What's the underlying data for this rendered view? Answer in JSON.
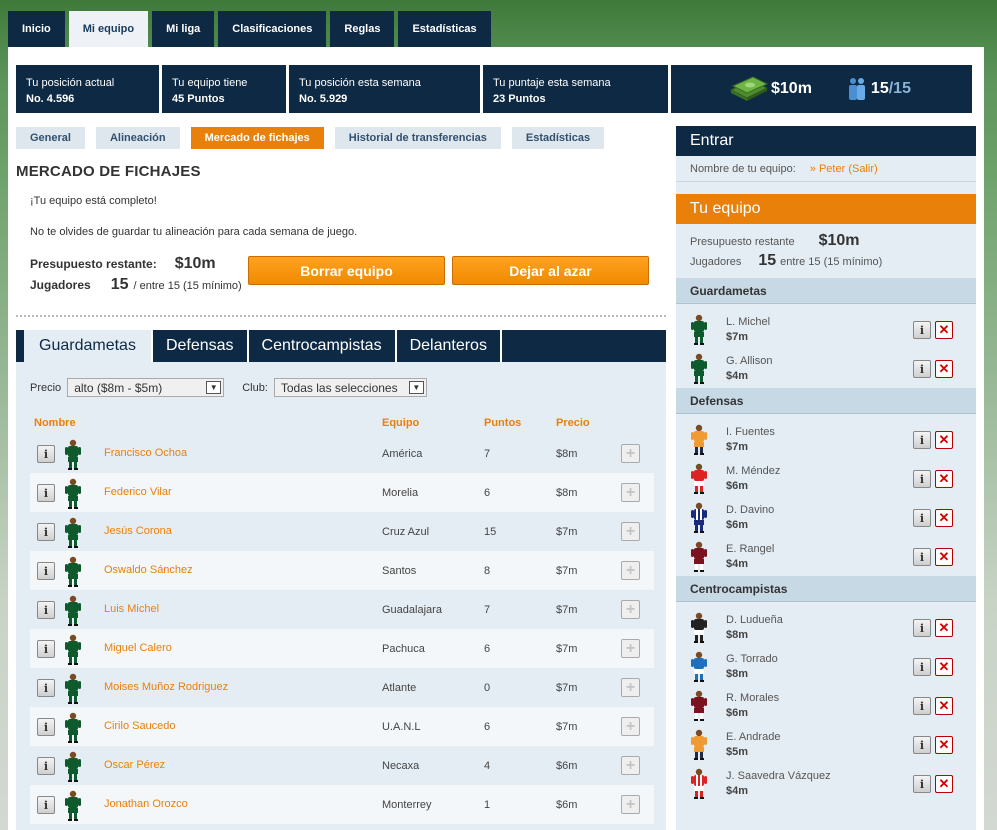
{
  "nav": {
    "tabs": [
      "Inicio",
      "Mi equipo",
      "Mi liga",
      "Clasificaciones",
      "Reglas",
      "Estadísticas"
    ],
    "active": 1
  },
  "stats": [
    {
      "label": "Tu posición actual",
      "value": "No. 4.596"
    },
    {
      "label": "Tu equipo tiene",
      "value": "45 Puntos"
    },
    {
      "label": "Tu posición esta semana",
      "value": "No. 5.929"
    },
    {
      "label": "Tu puntaje esta semana",
      "value": "23 Puntos"
    }
  ],
  "summary": {
    "budget": "$10m",
    "players_count": "15",
    "players_total": "/15"
  },
  "subtabs": {
    "items": [
      "General",
      "Alineación",
      "Mercado de fichajes",
      "Historial de transferencias",
      "Estadísticas"
    ],
    "active": 2
  },
  "market": {
    "title": "MERCADO DE FICHAJES",
    "complete_msg": "¡Tu equipo está completo!",
    "save_msg": "No te olvides de guardar tu alineación para cada semana de juego.",
    "budget_label": "Presupuesto restante:",
    "budget_value": "$10m",
    "players_label": "Jugadores",
    "players_value": "15",
    "players_note": "/ entre 15 (15 mínimo)",
    "clear_button": "Borrar equipo",
    "random_button": "Dejar al azar"
  },
  "position_tabs": {
    "items": [
      "Guardametas",
      "Defensas",
      "Centrocampistas",
      "Delanteros"
    ],
    "active": 0
  },
  "filters": {
    "price_label": "Precio",
    "price_value": "alto ($8m - $5m)",
    "club_label": "Club:",
    "club_value": "Todas las selecciones"
  },
  "list": {
    "headers": {
      "name": "Nombre",
      "team": "Equipo",
      "points": "Puntos",
      "price": "Precio"
    },
    "rows": [
      {
        "name": "Francisco Ochoa",
        "team": "América",
        "points": "7",
        "price": "$8m"
      },
      {
        "name": "Federico Vilar",
        "team": "Morelia",
        "points": "6",
        "price": "$8m"
      },
      {
        "name": "Jesús Corona",
        "team": "Cruz Azul",
        "points": "15",
        "price": "$7m"
      },
      {
        "name": "Oswaldo Sánchez",
        "team": "Santos",
        "points": "8",
        "price": "$7m"
      },
      {
        "name": "Luis Michel",
        "team": "Guadalajara",
        "points": "7",
        "price": "$7m"
      },
      {
        "name": "Miguel Calero",
        "team": "Pachuca",
        "points": "6",
        "price": "$7m"
      },
      {
        "name": "Moises Muñoz Rodriguez",
        "team": "Atlante",
        "points": "0",
        "price": "$7m"
      },
      {
        "name": "Cirilo Saucedo",
        "team": "U.A.N.L",
        "points": "6",
        "price": "$7m"
      },
      {
        "name": "Oscar Pérez",
        "team": "Necaxa",
        "points": "4",
        "price": "$6m"
      },
      {
        "name": "Jonathan Orozco",
        "team": "Monterrey",
        "points": "1",
        "price": "$6m"
      }
    ]
  },
  "login": {
    "title": "Entrar",
    "team_label": "Nombre de tu equipo:",
    "team_link": "» Peter (Salir)"
  },
  "team": {
    "title": "Tu equipo",
    "budget_label": "Presupuesto restante",
    "budget_value": "$10m",
    "players_label": "Jugadores",
    "players_value": "15",
    "players_note": "entre 15 (15 mínimo)",
    "groups": [
      {
        "name": "Guardametas",
        "players": [
          {
            "name": "L. Michel",
            "price": "$7m",
            "kit": "green"
          },
          {
            "name": "G. Allison",
            "price": "$4m",
            "kit": "green"
          }
        ]
      },
      {
        "name": "Defensas",
        "players": [
          {
            "name": "I. Fuentes",
            "price": "$7m",
            "kit": "orange"
          },
          {
            "name": "M. Méndez",
            "price": "$6m",
            "kit": "red-white"
          },
          {
            "name": "D. Davino",
            "price": "$6m",
            "kit": "blue-white-stripes"
          },
          {
            "name": "E. Rangel",
            "price": "$4m",
            "kit": "maroon"
          }
        ]
      },
      {
        "name": "Centrocampistas",
        "players": [
          {
            "name": "D. Ludueña",
            "price": "$8m",
            "kit": "black"
          },
          {
            "name": "G. Torrado",
            "price": "$8m",
            "kit": "blue"
          },
          {
            "name": "R. Morales",
            "price": "$6m",
            "kit": "maroon"
          },
          {
            "name": "E. Andrade",
            "price": "$5m",
            "kit": "orange"
          },
          {
            "name": "J. Saavedra Vázquez",
            "price": "$4m",
            "kit": "red-white-stripes"
          }
        ]
      }
    ]
  },
  "icons": {
    "money": "money-stack-icon",
    "players": "players-icon",
    "info": "info-icon",
    "remove": "remove-icon",
    "add": "add-icon",
    "dropdown": "dropdown-arrow-icon"
  },
  "colors": {
    "navy": "#0e2944",
    "orange": "#e9800a",
    "panel": "#e5edf4"
  }
}
